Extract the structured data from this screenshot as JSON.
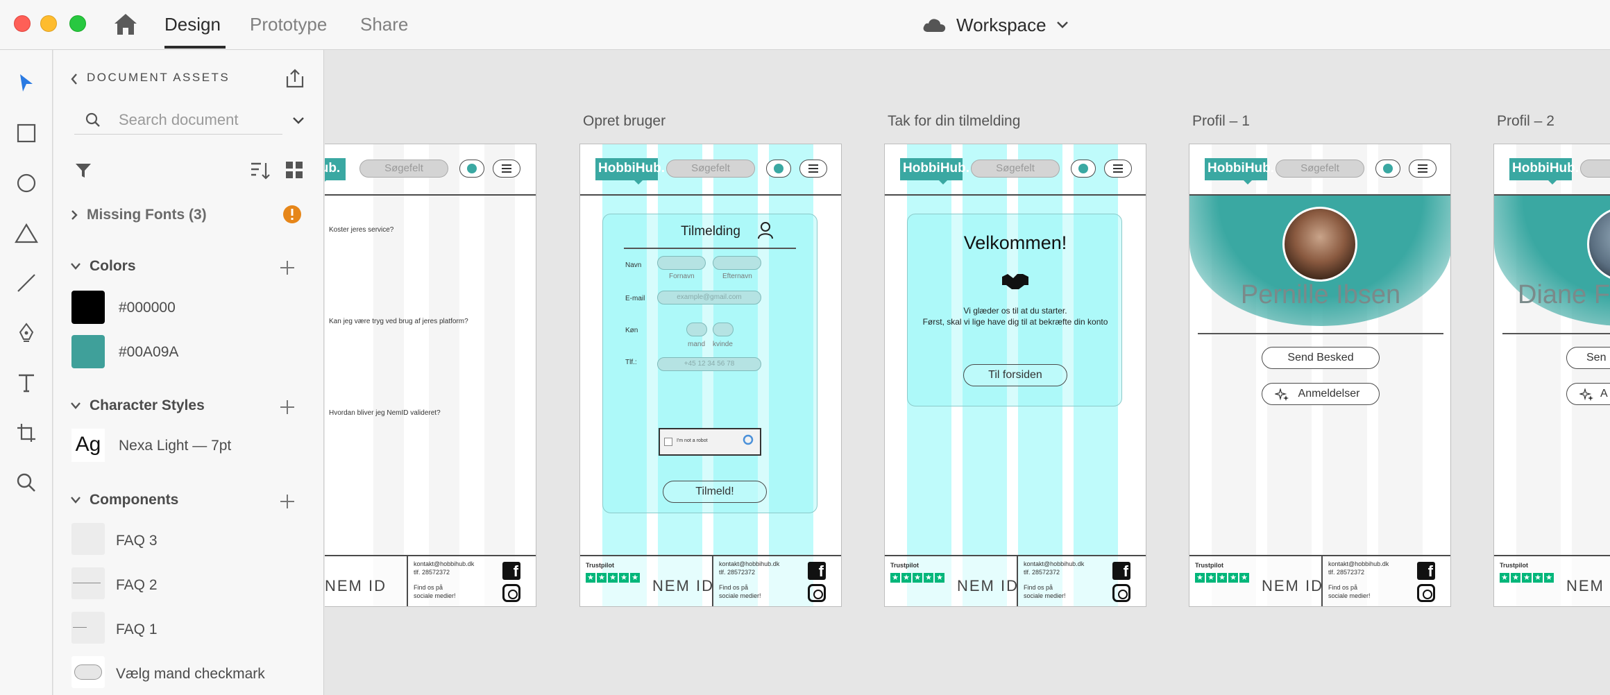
{
  "window": {
    "tabs": [
      {
        "label": "Design",
        "active": true
      },
      {
        "label": "Prototype",
        "active": false
      },
      {
        "label": "Share",
        "active": false
      }
    ],
    "workspace_label": "Workspace"
  },
  "tools": [
    "select-icon",
    "rectangle-icon",
    "ellipse-icon",
    "triangle-icon",
    "line-icon",
    "pen-icon",
    "text-icon",
    "artboard-icon",
    "zoom-icon"
  ],
  "assets": {
    "title": "DOCUMENT ASSETS",
    "search_placeholder": "Search document",
    "missing_fonts": "Missing Fonts (3)",
    "colors_heading": "Colors",
    "colors": [
      {
        "hex": "#000000",
        "label": "#000000"
      },
      {
        "hex": "#00A09A",
        "label": "#00A09A"
      }
    ],
    "char_styles_heading": "Character Styles",
    "char_style": {
      "sample": "Ag",
      "label": "Nexa Light — 7pt"
    },
    "components_heading": "Components",
    "components": [
      "FAQ 3",
      "FAQ 2",
      "FAQ 1",
      "Vælg mand checkmark"
    ]
  },
  "artboards": {
    "faq": {
      "logo": "Hub.",
      "search": "Søgefelt",
      "questions": [
        "Koster jeres service?",
        "Kan jeg være tryg ved brug af jeres platform?",
        "Hvordan bliver jeg NemID valideret?"
      ]
    },
    "opret": {
      "title": "Opret bruger",
      "logo": "HobbiHub.",
      "search": "Søgefelt",
      "form_title": "Tilmelding",
      "navn_label": "Navn",
      "fornavn": "Fornavn",
      "efternavn": "Efternavn",
      "email_label": "E-mail",
      "email_placeholder": "example@gmail.com",
      "kon_label": "Køn",
      "mand": "mand",
      "kvinde": "kvinde",
      "tlf_label": "Tlf.:",
      "tlf_placeholder": "+45 12 34 56 78",
      "captcha": "I'm not a robot",
      "submit": "Tilmeld!"
    },
    "tak": {
      "title": "Tak for din tilmelding",
      "logo": "HobbiHub.",
      "search": "Søgefelt",
      "welcome": "Velkommen!",
      "line1": "Vi glæder os til at du starter.",
      "line2": "Først, skal vi lige have dig til at bekræfte din konto",
      "button": "Til forsiden"
    },
    "profil1": {
      "title": "Profil – 1",
      "logo": "HobbiHub.",
      "search": "Søgefelt",
      "name": "Pernille Ibsen",
      "send": "Send Besked",
      "reviews": "Anmeldelser"
    },
    "profil2": {
      "title": "Profil – 2",
      "logo": "HobbiHub.",
      "search": "S",
      "name": "Diane F",
      "send": "Sen",
      "reviews": "A"
    }
  },
  "footer": {
    "trustpilot": "Trustpilot",
    "nemid": "NEM ID",
    "email": "kontakt@hobbihub.dk",
    "phone": "tlf. 28572372",
    "find1": "Find os på",
    "find2": "sociale medier!"
  }
}
